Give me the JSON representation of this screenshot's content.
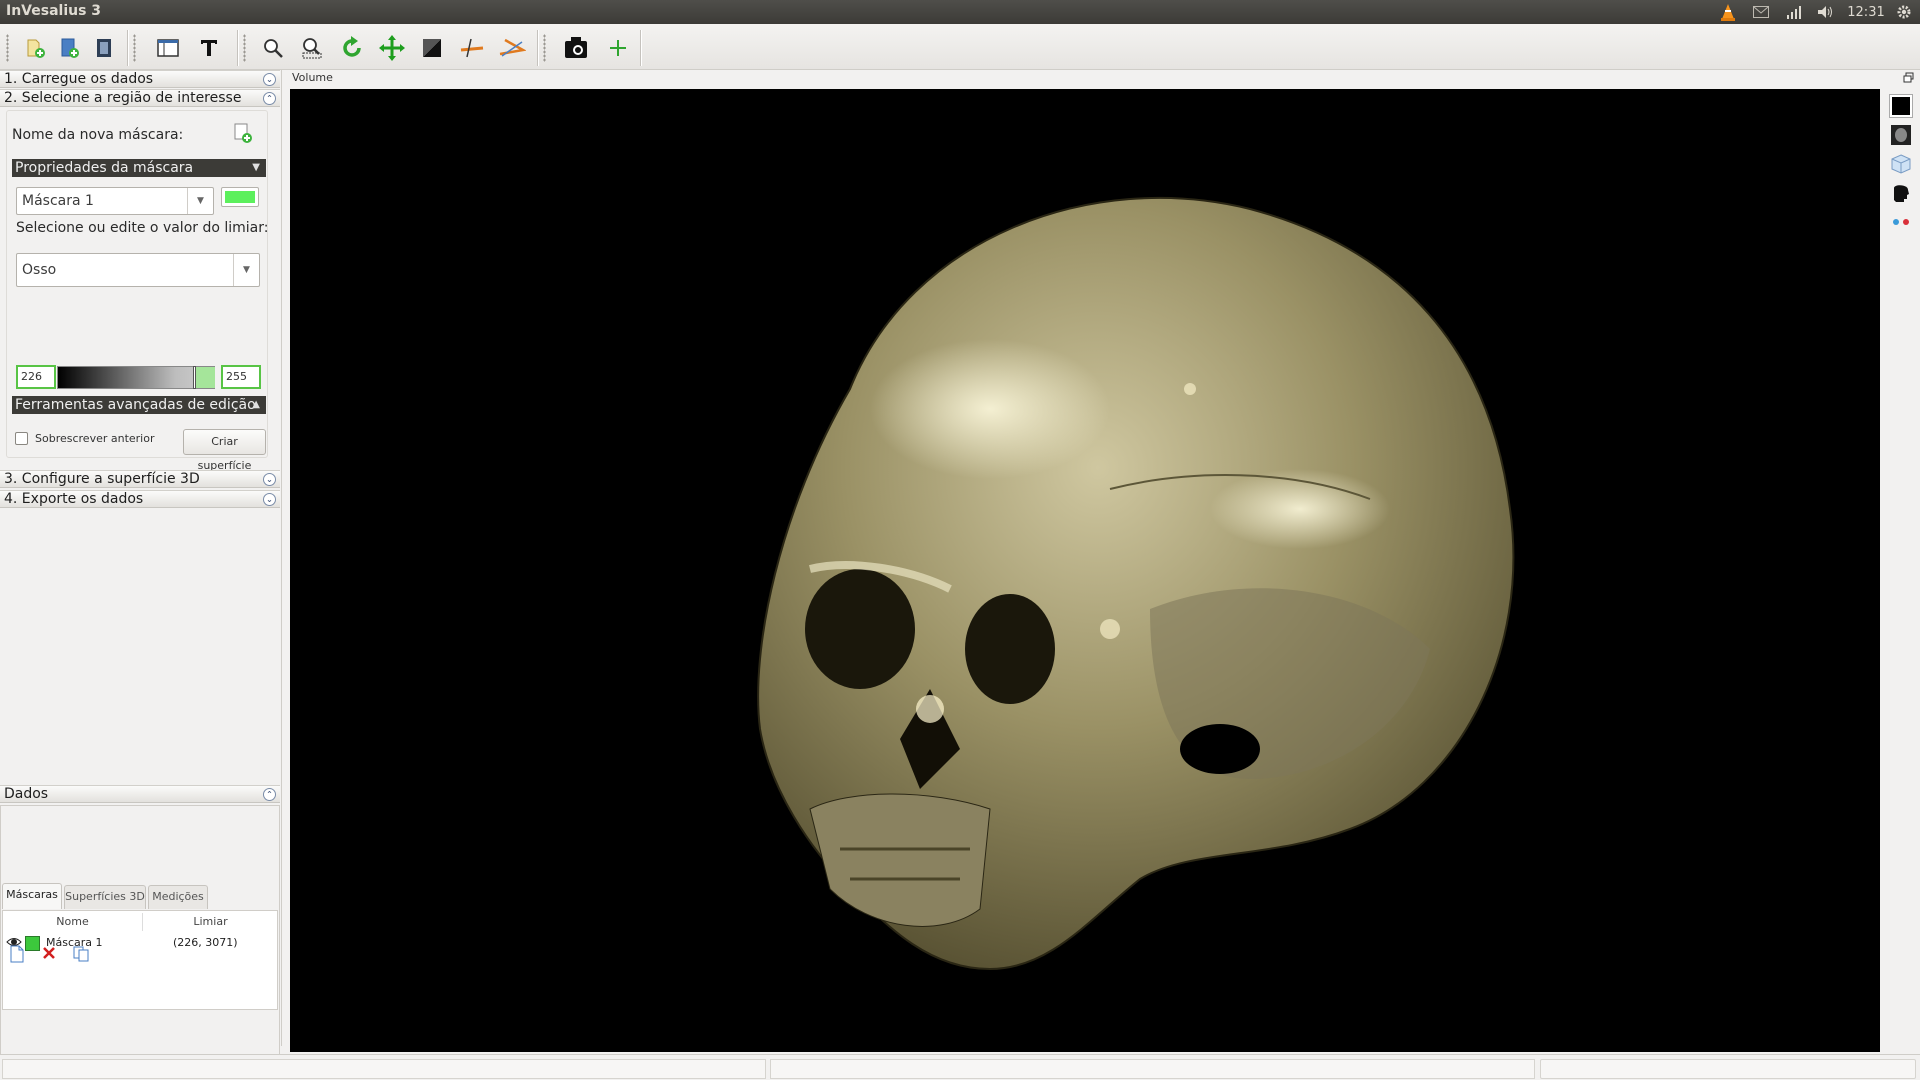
{
  "topbar": {
    "app_title": "InVesalius 3",
    "clock": "12:31",
    "tray_icons": [
      "vlc-icon",
      "mail-icon",
      "network-icon",
      "volume-icon",
      "gear-icon"
    ]
  },
  "toolbar": {
    "buttons": [
      "import-dicom",
      "import-other",
      "export",
      "layout",
      "text",
      "zoom",
      "zoom-select",
      "rotate",
      "pan",
      "contrast",
      "measure-distance",
      "measure-angle",
      "snapshot",
      "add"
    ]
  },
  "steps": {
    "step1": "1. Carregue os dados",
    "step2": "2. Selecione a região de interesse",
    "step3": "3. Configure a superfície 3D",
    "step4": "4. Exporte os dados"
  },
  "mask_panel": {
    "new_mask_label": "Nome da nova máscara:",
    "properties_header": "Propriedades da máscara",
    "mask_selected": "Máscara 1",
    "mask_color": "#5cf05c",
    "threshold_prompt": "Selecione ou edite o valor do limiar:",
    "threshold_preset": "Osso",
    "threshold_min": "226",
    "threshold_max": "255",
    "advanced_header": "Ferramentas avançadas de edição",
    "overwrite_label": "Sobrescrever anterior",
    "overwrite_checked": false,
    "create_surface_button": "Criar superfície"
  },
  "data_panel": {
    "title": "Dados",
    "tabs": [
      "Máscaras",
      "Superfícies 3D",
      "Medições"
    ],
    "active_tab": "Máscaras",
    "columns": [
      "Nome",
      "Limiar"
    ],
    "rows": [
      {
        "name": "Máscara 1",
        "threshold": "(226, 3071)",
        "color": "#3cc83c",
        "visible": true
      }
    ]
  },
  "viewport": {
    "label": "Volume",
    "background": "#000000",
    "surface_color": "#8c845a"
  },
  "colors": {
    "accent_green": "#58c445",
    "dark_header": "#3c3b37",
    "topbar": "#3c3b37"
  }
}
